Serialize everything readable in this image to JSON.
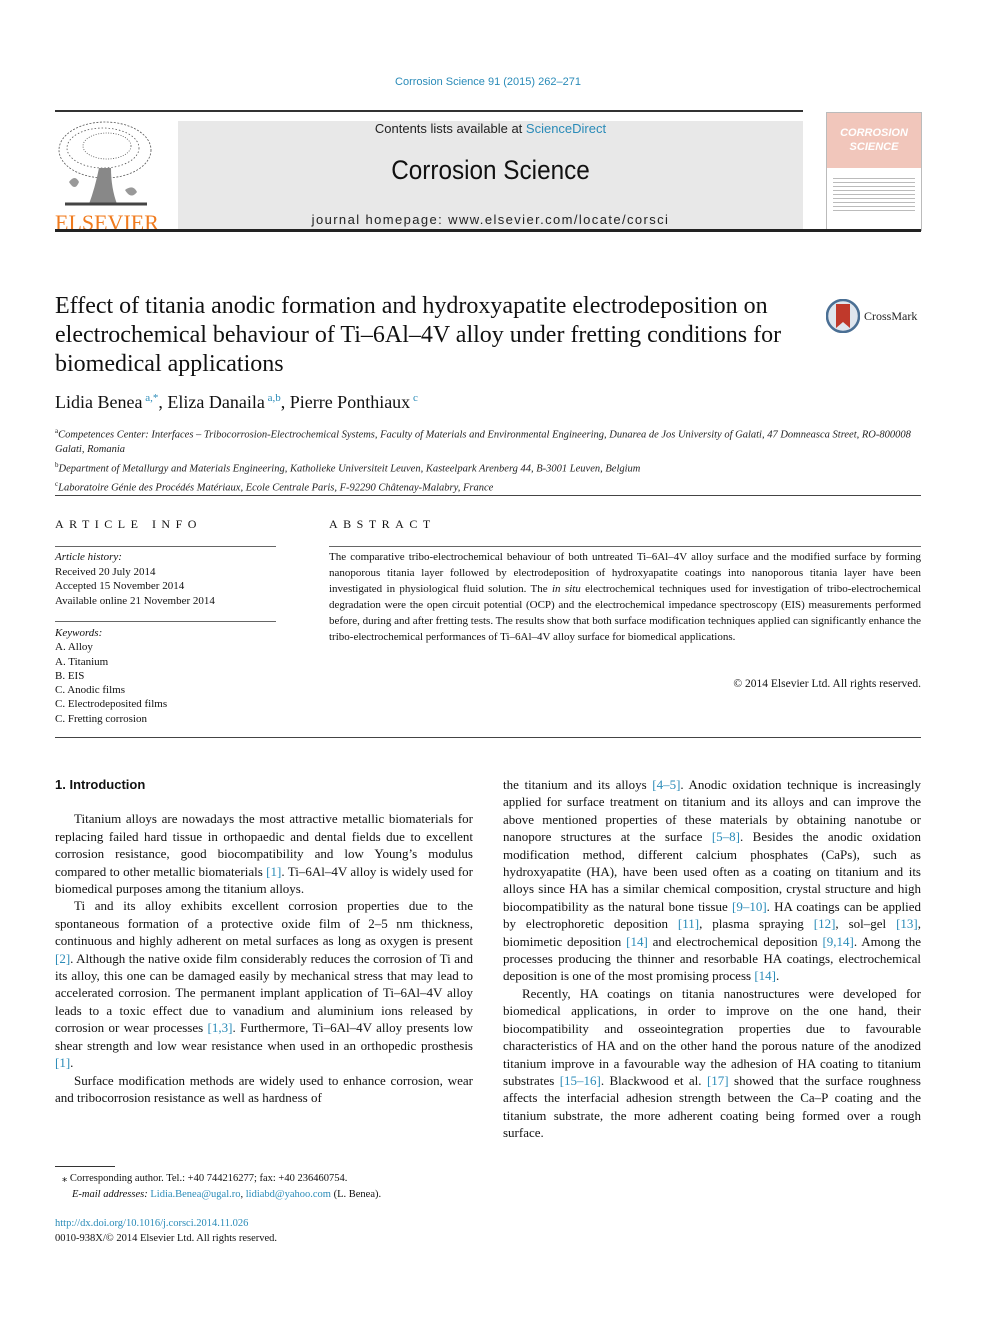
{
  "header": {
    "citation": "Corrosion Science 91 (2015) 262–271",
    "contents_prefix": "Contents lists available at ",
    "contents_link": "ScienceDirect",
    "journal_title": "Corrosion Science",
    "homepage": "journal homepage: www.elsevier.com/locate/corsci",
    "publisher_logo_text": "ELSEVIER",
    "cover_title_line1": "CORROSION",
    "cover_title_line2": "SCIENCE",
    "colors": {
      "link": "#2a8bb8",
      "elsevier_orange": "#f07b1e",
      "masthead_bg": "#e8e8e8",
      "cover_pink": "#f1c6bb",
      "crossmark_red": "#c0392b"
    }
  },
  "article": {
    "title": "Effect of titania anodic formation and hydroxyapatite electrodeposition on electrochemical behaviour of Ti–6Al–4V alloy under fretting conditions for biomedical applications",
    "crossmark_label": "CrossMark",
    "authors": [
      {
        "name": "Lidia Benea",
        "sup": "a,*"
      },
      {
        "name": "Eliza Danaila",
        "sup": "a,b"
      },
      {
        "name": "Pierre Ponthiaux",
        "sup": "c"
      }
    ],
    "affiliations": [
      {
        "key": "a",
        "text": "Competences Center: Interfaces – Tribocorrosion-Electrochemical Systems, Faculty of Materials and Environmental Engineering, Dunarea de Jos University of Galati, 47 Domneasca Street, RO-800008 Galati, Romania"
      },
      {
        "key": "b",
        "text": "Department of Metallurgy and Materials Engineering, Katholieke Universiteit Leuven, Kasteelpark Arenberg 44, B-3001 Leuven, Belgium"
      },
      {
        "key": "c",
        "text": "Laboratoire Génie des Procédés Matériaux, Ecole Centrale Paris, F-92290 Châtenay-Malabry, France"
      }
    ]
  },
  "article_info": {
    "heading": "ARTICLE INFO",
    "history_label": "Article history:",
    "history": [
      "Received 20 July 2014",
      "Accepted 15 November 2014",
      "Available online 21 November 2014"
    ],
    "keywords_label": "Keywords:",
    "keywords": [
      "A. Alloy",
      "A. Titanium",
      "B. EIS",
      "C. Anodic films",
      "C. Electrodeposited films",
      "C. Fretting corrosion"
    ]
  },
  "abstract": {
    "heading": "ABSTRACT",
    "text_part1": "The comparative tribo-electrochemical behaviour of both untreated Ti–6Al–4V alloy surface and the modified surface by forming nanoporous titania layer followed by electrodeposition of hydroxyapatite coatings into nanoporous titania layer have been investigated in physiological fluid solution. The ",
    "text_italic": "in situ",
    "text_part2": " electrochemical techniques used for investigation of tribo-electrochemical degradation were the open circuit potential (OCP) and the electrochemical impedance spectroscopy (EIS) measurements performed before, during and after fretting tests. The results show that both surface modification techniques applied can significantly enhance the tribo-electrochemical performances of Ti–6Al–4V alloy surface for biomedical applications.",
    "copyright": "© 2014 Elsevier Ltd. All rights reserved."
  },
  "body": {
    "section_heading": "1. Introduction",
    "left_paragraphs": [
      [
        {
          "t": "Titanium alloys are nowadays the most attractive metallic biomaterials for replacing failed hard tissue in orthopaedic and dental fields due to excellent corrosion resistance, good biocompatibility and low Young’s modulus compared to other metallic biomaterials "
        },
        {
          "r": "[1]"
        },
        {
          "t": ". Ti–6Al–4V alloy is widely used for biomedical purposes among the titanium alloys."
        }
      ],
      [
        {
          "t": "Ti and its alloy exhibits excellent corrosion properties due to the spontaneous formation of a protective oxide film of 2–5 nm thickness, continuous and highly adherent on metal surfaces as long as oxygen is present "
        },
        {
          "r": "[2]"
        },
        {
          "t": ". Although the native oxide film considerably reduces the corrosion of Ti and its alloy, this one can be damaged easily by mechanical stress that may lead to accelerated corrosion. The permanent implant application of Ti–6Al–4V alloy leads to a toxic effect due to vanadium and aluminium ions released by corrosion or wear processes "
        },
        {
          "r": "[1,3]"
        },
        {
          "t": ". Furthermore, Ti–6Al–4V alloy presents low shear strength and low wear resistance when used in an orthopedic prosthesis "
        },
        {
          "r": "[1]"
        },
        {
          "t": "."
        }
      ],
      [
        {
          "t": "Surface modification methods are widely used to enhance corrosion, wear and tribocorrosion resistance as well as hardness of"
        }
      ]
    ],
    "right_paragraphs": [
      [
        {
          "t": "the titanium and its alloys "
        },
        {
          "r": "[4–5]"
        },
        {
          "t": ". Anodic oxidation technique is increasingly applied for surface treatment on titanium and its alloys and can improve the above mentioned properties of these materials by obtaining nanotube or nanopore structures at the surface "
        },
        {
          "r": "[5–8]"
        },
        {
          "t": ". Besides the anodic oxidation modification method, different calcium phosphates (CaPs), such as hydroxyapatite (HA), have been used often as a coating on titanium and its alloys since HA has a similar chemical composition, crystal structure and high biocompatibility as the natural bone tissue "
        },
        {
          "r": "[9–10]"
        },
        {
          "t": ". HA coatings can be applied by electrophoretic deposition "
        },
        {
          "r": "[11]"
        },
        {
          "t": ", plasma spraying "
        },
        {
          "r": "[12]"
        },
        {
          "t": ", sol–gel "
        },
        {
          "r": "[13]"
        },
        {
          "t": ", biomimetic deposition "
        },
        {
          "r": "[14]"
        },
        {
          "t": " and electrochemical deposition "
        },
        {
          "r": "[9,14]"
        },
        {
          "t": ". Among the processes producing the thinner and resorbable HA coatings, electrochemical deposition is one of the most promising process "
        },
        {
          "r": "[14]"
        },
        {
          "t": "."
        }
      ],
      [
        {
          "t": "Recently, HA coatings on titania nanostructures were developed for biomedical applications, in order to improve on the one hand, their biocompatibility and osseointegration properties due to favourable characteristics of HA and on the other hand the porous nature of the anodized titanium improve in a favourable way the adhesion of HA coating to titanium substrates "
        },
        {
          "r": "[15–16]"
        },
        {
          "t": ". Blackwood et al. "
        },
        {
          "r": "[17]"
        },
        {
          "t": " showed that the surface roughness affects the interfacial adhesion strength between the Ca–P coating and the titanium substrate, the more adherent coating being formed over a rough surface."
        }
      ]
    ]
  },
  "footnotes": {
    "corresponding": "Corresponding author. Tel.: +40 744216277; fax: +40 236460754.",
    "corresponding_mark": "⁎",
    "email_label": "E-mail addresses: ",
    "email1": "Lidia.Benea@ugal.ro",
    "email2": "lidiabd@yahoo.com",
    "email_suffix": " (L. Benea).",
    "doi": "http://dx.doi.org/10.1016/j.corsci.2014.11.026",
    "issn_copyright": "0010-938X/© 2014 Elsevier Ltd. All rights reserved."
  }
}
